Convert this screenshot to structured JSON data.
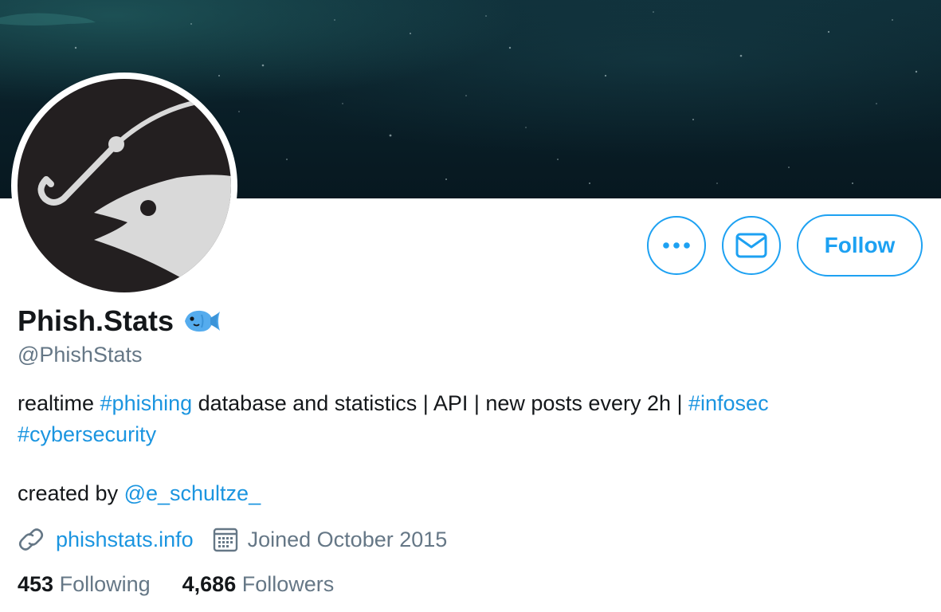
{
  "profile": {
    "display_name": "Phish.Stats",
    "handle": "@PhishStats",
    "name_emoji_icon": "fish-emoji-icon"
  },
  "actions": {
    "more_icon": "more-dots-icon",
    "message_icon": "envelope-icon",
    "follow_label": "Follow"
  },
  "bio": {
    "line1_text1": "realtime ",
    "line1_hashtag1": "#phishing",
    "line1_text2": " database and statistics | API | new posts every 2h | ",
    "line1_hashtag2": "#infosec",
    "line2_hashtag": "#cybersecurity",
    "created_prefix": "created by ",
    "created_mention": "@e_schultze_"
  },
  "meta": {
    "website_icon": "link-icon",
    "website": "phishstats.info",
    "joined_icon": "calendar-icon",
    "joined": "Joined October 2015"
  },
  "stats": {
    "following_count": "453",
    "following_label": "Following",
    "followers_count": "4,686",
    "followers_label": "Followers"
  },
  "colors": {
    "accent": "#1da1f2",
    "link": "#1b95e0",
    "secondary_text": "#657786",
    "primary_text": "#14171a"
  }
}
